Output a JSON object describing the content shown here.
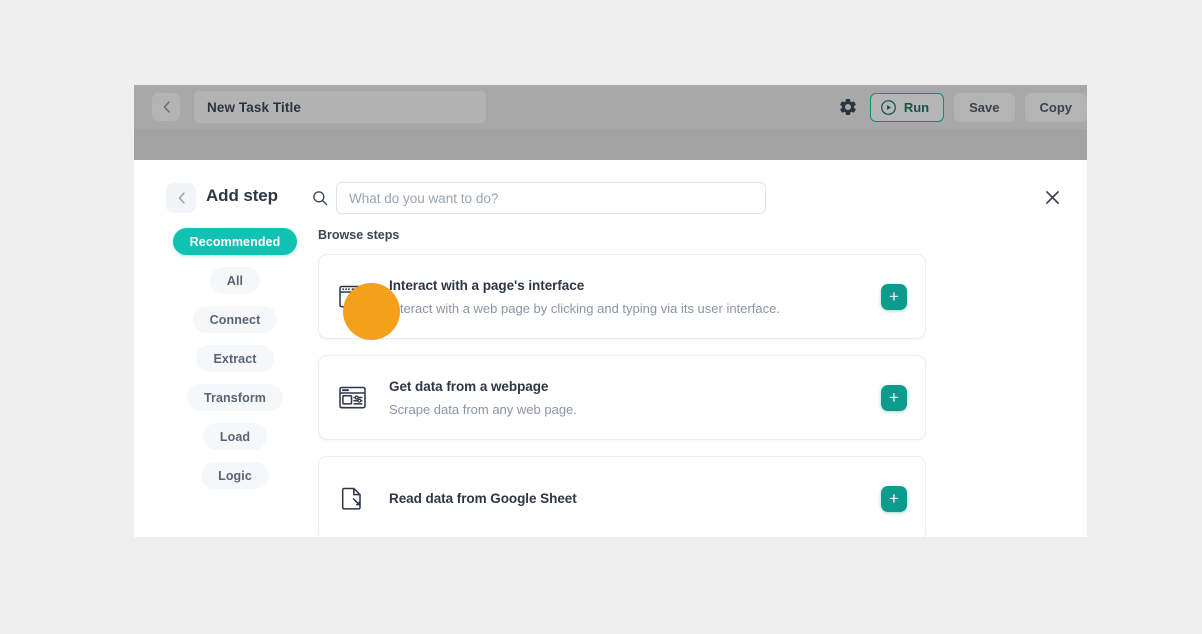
{
  "toolbar": {
    "back_icon": "chevron-left-icon",
    "task_title": "New Task Title",
    "gear_icon": "gear-icon",
    "run_label": "Run",
    "run_icon": "play-circle-icon",
    "save_label": "Save",
    "copy_label": "Copy"
  },
  "modal": {
    "back_icon": "chevron-left-icon",
    "title": "Add step",
    "search_icon": "search-icon",
    "search_placeholder": "What do you want to do?",
    "search_value": "",
    "close_icon": "close-icon"
  },
  "sidebar": {
    "items": [
      {
        "label": "Recommended",
        "active": true
      },
      {
        "label": "All",
        "active": false
      },
      {
        "label": "Connect",
        "active": false
      },
      {
        "label": "Extract",
        "active": false
      },
      {
        "label": "Transform",
        "active": false
      },
      {
        "label": "Load",
        "active": false
      },
      {
        "label": "Logic",
        "active": false
      }
    ]
  },
  "main": {
    "browse_label": "Browse steps",
    "add_button_label": "+",
    "steps": [
      {
        "title": "Interact with a page's interface",
        "description": "Interact with a web page by clicking and typing via its user interface.",
        "icon": "browser-cursor-icon"
      },
      {
        "title": "Get data from a webpage",
        "description": "Scrape data from any web page.",
        "icon": "browser-data-icon"
      },
      {
        "title": "Read data from Google Sheet",
        "description": "",
        "icon": "document-icon"
      }
    ]
  },
  "colors": {
    "accent_teal": "#11c2b3",
    "button_teal": "#0d9b8e",
    "cursor_highlight": "#f3a11a",
    "text_dark": "#2e3647",
    "text_muted": "#8c94a3"
  }
}
